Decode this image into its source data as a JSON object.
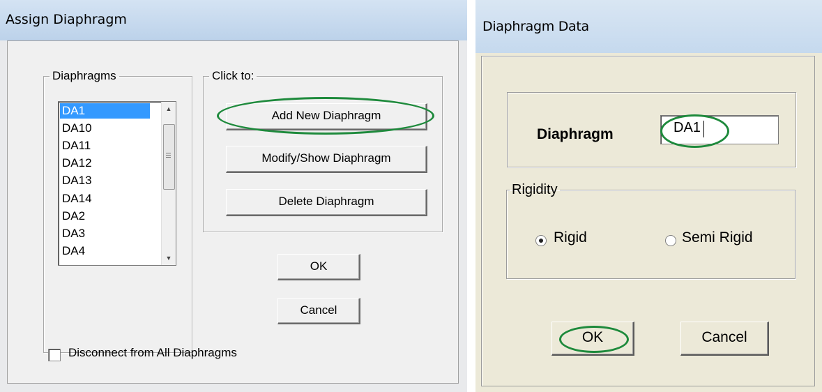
{
  "assign_dialog": {
    "title": "Assign Diaphragm",
    "diaphragms_group_label": "Diaphragms",
    "diaphragms": [
      "DA1",
      "DA10",
      "DA11",
      "DA12",
      "DA13",
      "DA14",
      "DA2",
      "DA3",
      "DA4"
    ],
    "selected": "DA1",
    "click_to_group_label": "Click to:",
    "add_button": "Add New Diaphragm",
    "modify_button": "Modify/Show Diaphragm",
    "delete_button": "Delete Diaphragm",
    "ok_button": "OK",
    "cancel_button": "Cancel",
    "disconnect_checkbox_label": "Disconnect from All Diaphragms",
    "disconnect_checked": false
  },
  "data_dialog": {
    "title": "Diaphragm Data",
    "diaphragm_label": "Diaphragm",
    "diaphragm_value": "DA1",
    "rigidity_group_label": "Rigidity",
    "rigid_label": "Rigid",
    "semi_rigid_label": "Semi Rigid",
    "selected_rigidity": "Rigid",
    "ok_button": "OK",
    "cancel_button": "Cancel"
  },
  "colors": {
    "highlight_ellipse": "#1e8a3c",
    "list_selection": "#3399ff"
  }
}
